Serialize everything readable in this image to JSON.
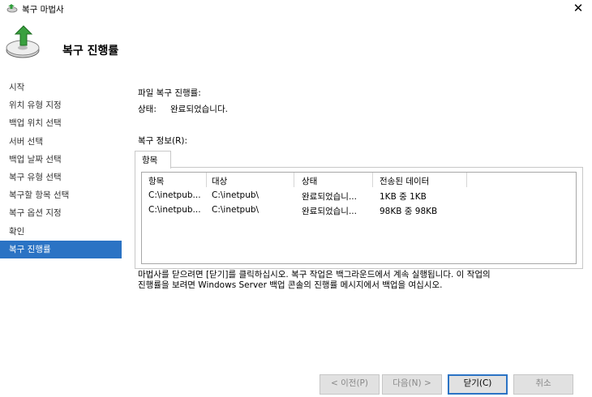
{
  "window": {
    "title": "복구 마법사",
    "close_glyph": "✕"
  },
  "header": {
    "title": "복구 진행률",
    "icon": "recovery-wizard-icon"
  },
  "sidebar": {
    "items": [
      {
        "label": "시작"
      },
      {
        "label": "위치 유형 지정"
      },
      {
        "label": "백업 위치 선택"
      },
      {
        "label": "서버 선택"
      },
      {
        "label": "백업 날짜 선택"
      },
      {
        "label": "복구 유형 선택"
      },
      {
        "label": "복구할 항목 선택"
      },
      {
        "label": "복구 옵션 지정"
      },
      {
        "label": "확인"
      },
      {
        "label": "복구 진행률"
      }
    ],
    "active_index": 9,
    "active_color": "#2b73c4"
  },
  "main": {
    "file_progress_label": "파일 복구 진행률:",
    "status_label": "상태:",
    "status_value": "완료되었습니다.",
    "recovery_info_label": "복구 정보(R):",
    "tab_label": "항목",
    "columns": [
      "항목",
      "대상",
      "상태",
      "전송된 데이터"
    ],
    "rows": [
      {
        "item": "C:\\inetpub...",
        "target": "C:\\inetpub\\",
        "status": "완료되었습니...",
        "data": "1KB 중 1KB"
      },
      {
        "item": "C:\\inetpub...",
        "target": "C:\\inetpub\\",
        "status": "완료되었습니...",
        "data": "98KB 중 98KB"
      }
    ],
    "info_line1": "마법사를 닫으려면 [닫기]를 클릭하십시오. 복구 작업은 백그라운드에서 계속 실행됩니다. 이 작업의",
    "info_line2": "진행률을 보려면 Windows Server 백업 콘솔의 진행률 메시지에서 백업을 여십시오."
  },
  "buttons": {
    "prev": "< 이전(P)",
    "next": "다음(N) >",
    "close": "닫기(C)",
    "cancel": "취소"
  }
}
